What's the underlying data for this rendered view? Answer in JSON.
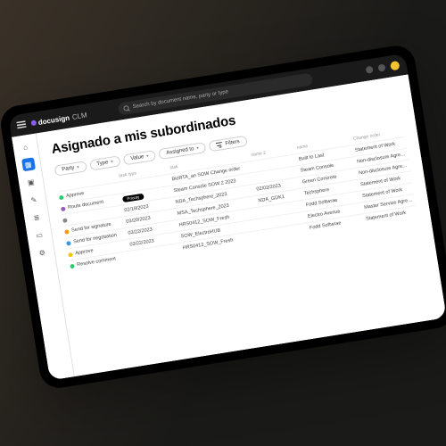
{
  "topbar": {
    "brand": "docusign",
    "brand_sub": "CLM",
    "search_placeholder": "Search by document name, party or type"
  },
  "page": {
    "title": "Asignado a mis subordinados"
  },
  "filters": {
    "items": [
      {
        "label": "Party"
      },
      {
        "label": "Type"
      },
      {
        "label": "Value"
      },
      {
        "label": "Assigned to"
      }
    ],
    "filters_button": "Filters"
  },
  "sidebar": {
    "icons": [
      "home",
      "dashboard",
      "box",
      "edit",
      "list",
      "folder",
      "settings"
    ]
  },
  "table": {
    "headers": [
      "",
      "task type",
      "task",
      "name 2",
      "name",
      "Change order"
    ],
    "rows": [
      {
        "status": {
          "color": "#2ecc71",
          "label": "Approve"
        },
        "task_type": "",
        "task": "BioRTA_an SOW Change order",
        "col4": "",
        "col5": "Built to Last",
        "col6": "Statement of Work"
      },
      {
        "status": {
          "color": "#9b59b6",
          "label": "Route document"
        },
        "task_type": "Priority",
        "task": "Steam Console SOW 2 2023",
        "col4": "",
        "col5": "Steam Console",
        "col6": "Non-disclosure Agreem..."
      },
      {
        "status": {
          "color": "#888888",
          "label": ""
        },
        "task_type": "02/18/2023",
        "task": "NDA_Techsphere_2023",
        "col4": "02/02/2023",
        "col5": "Green Concrete",
        "col6": "Non-disclosure Agreem..."
      },
      {
        "status": {
          "color": "#f39c12",
          "label": "Send for signature"
        },
        "task_type": "03/20/2023",
        "task": "MSA_Techsphere_2023",
        "col4": "NDA_GDK1",
        "col5": "Techsphere",
        "col6": "Statement of Work"
      },
      {
        "status": {
          "color": "#3498db",
          "label": "Send for negotiation"
        },
        "task_type": "03/22/2023",
        "task": "HRS0412_SOW_Fresh",
        "col4": "",
        "col5": "Fodd Softwrae",
        "col6": "Statement of Work"
      },
      {
        "status": {
          "color": "#f1c40f",
          "label": "Approve"
        },
        "task_type": "03/22/2023",
        "task": "SOW_ElectroHUB",
        "col4": "",
        "col5": "Electro Avenue",
        "col6": "Master Service Agreeme..."
      },
      {
        "status": {
          "color": "#2ecc71",
          "label": "Resolve comment"
        },
        "task_type": "",
        "task": "HRS0412_SOW_Fresh",
        "col4": "",
        "col5": "Fodd Softwrae",
        "col6": "Statement of Work"
      }
    ]
  },
  "colors": {
    "status_green": "#2ecc71",
    "status_purple": "#9b59b6",
    "status_orange": "#f39c12",
    "status_blue": "#3498db",
    "status_yellow": "#f1c40f"
  }
}
